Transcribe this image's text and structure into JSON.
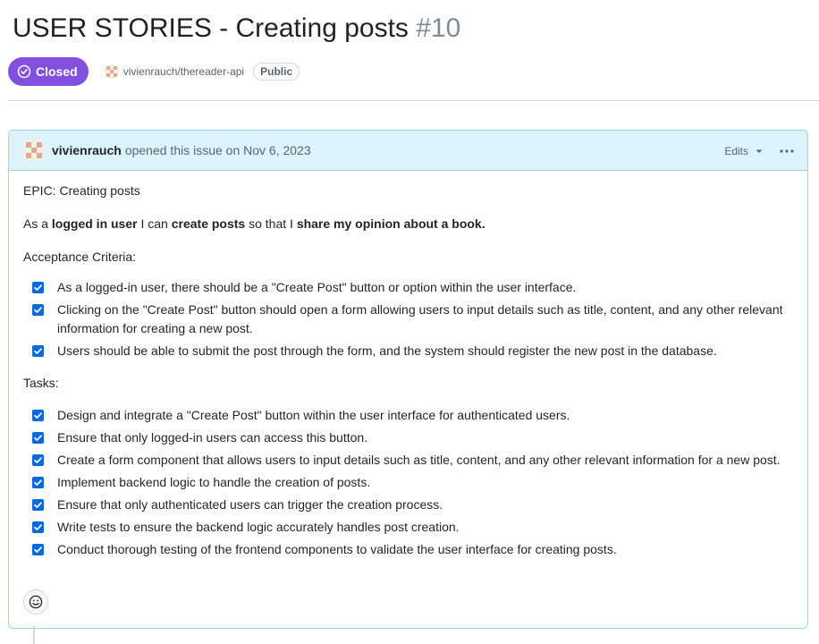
{
  "issue": {
    "title": "USER STORIES - Creating posts",
    "number": "#10",
    "state": "Closed",
    "state_color": "#8250df",
    "repo": "vivienrauch/thereader-api",
    "visibility": "Public"
  },
  "comment": {
    "author": "vivienrauch",
    "action": "opened this issue on Nov 6, 2023",
    "edits_label": "Edits",
    "epic": "EPIC: Creating posts",
    "story": {
      "pre": "As a ",
      "b1": "logged in user",
      "mid1": " I can ",
      "b2": "create posts",
      "mid2": " so that I ",
      "b3": "share my opinion about a book."
    },
    "criteria_heading": "Acceptance Criteria:",
    "criteria": [
      "As a logged-in user, there should be a \"Create Post\" button or option within the user interface.",
      "Clicking on the \"Create Post\" button should open a form allowing users to input details such as title, content, and any other relevant information for creating a new post.",
      "Users should be able to submit the post through the form, and the system should register the new post in the database."
    ],
    "tasks_heading": "Tasks:",
    "tasks": [
      "Design and integrate a \"Create Post\" button within the user interface for authenticated users.",
      "Ensure that only logged-in users can access this button.",
      "Create a form component that allows users to input details such as title, content, and any other relevant information for a new post.",
      "Implement backend logic to handle the creation of posts.",
      "Ensure that only authenticated users can trigger the creation process.",
      "Write tests to ensure the backend logic accurately handles post creation.",
      "Conduct thorough testing of the frontend components to validate the user interface for creating posts."
    ]
  },
  "icons": {
    "state": "check-circle-icon",
    "edits_caret": "triangle-down-icon",
    "more": "kebab-horizontal-icon",
    "reaction": "smiley-icon",
    "checkbox": "checked-checkbox-icon"
  }
}
